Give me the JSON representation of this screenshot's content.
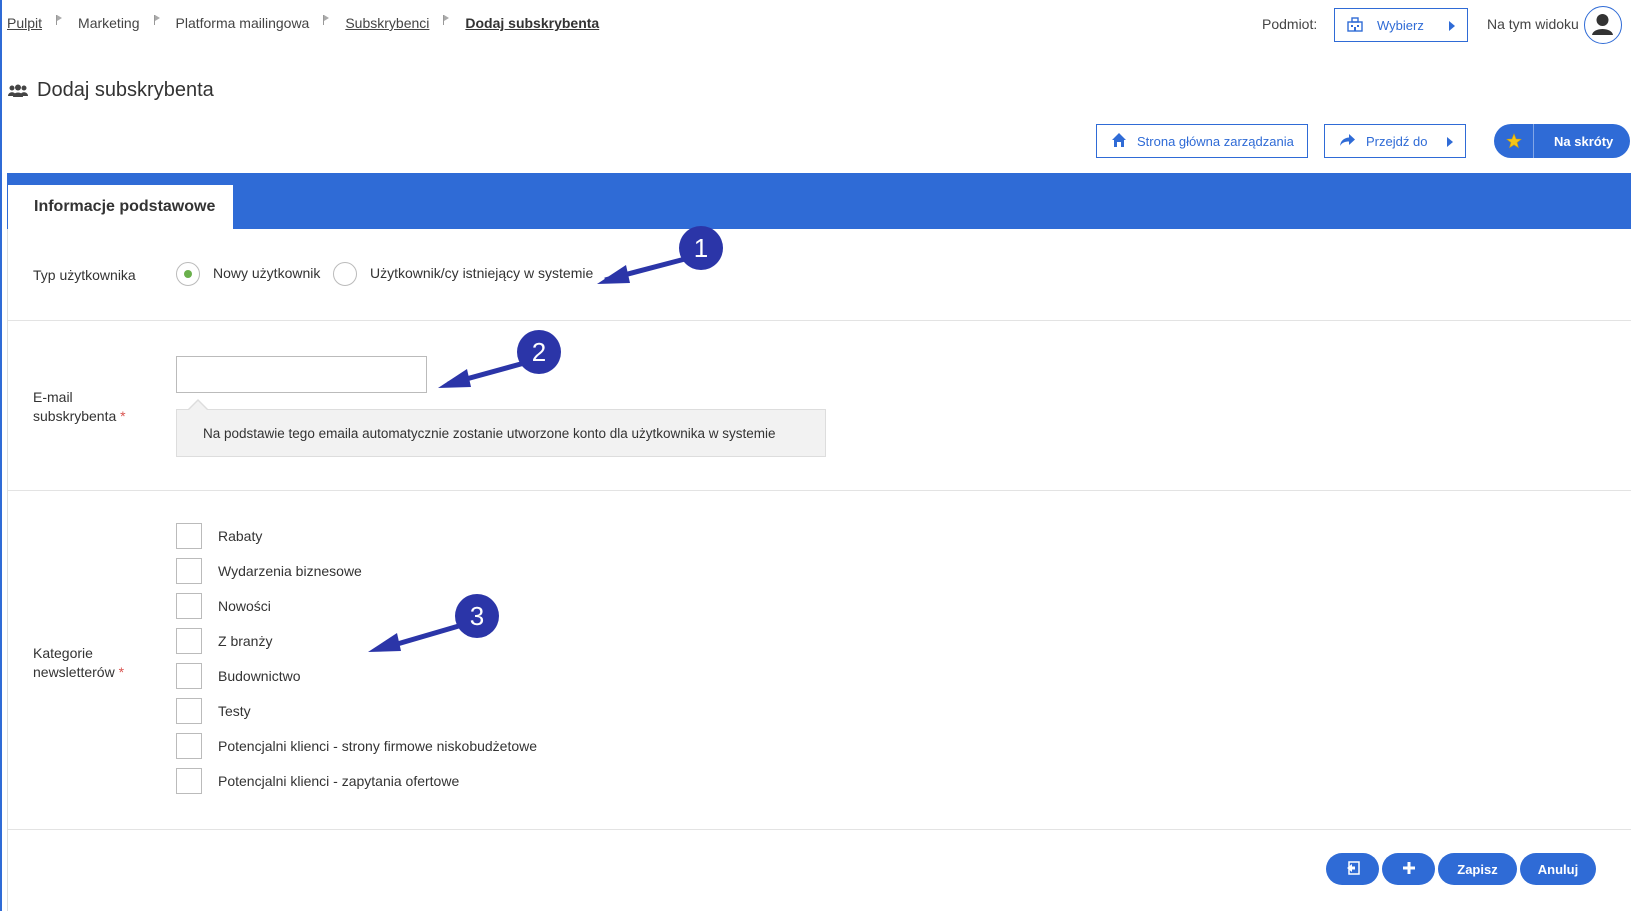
{
  "breadcrumb": {
    "items": [
      "Pulpit",
      "Marketing",
      "Platforma mailingowa",
      "Subskrybenci",
      "Dodaj subskrybenta"
    ]
  },
  "topbar": {
    "subject_label": "Podmiot:",
    "select_button": "Wybierz",
    "view_label": "Na tym widoku"
  },
  "page": {
    "title": "Dodaj subskrybenta"
  },
  "actions": {
    "home": "Strona główna zarządzania",
    "goto": "Przejdź do",
    "shortcuts": "Na skróty"
  },
  "tabs": {
    "active": "Informacje podstawowe"
  },
  "form": {
    "user_type": {
      "label": "Typ użytkownika",
      "options": [
        {
          "label": "Nowy użytkownik",
          "checked": true
        },
        {
          "label": "Użytkownik/cy istniejący w systemie",
          "checked": false
        }
      ]
    },
    "email": {
      "label_line1": "E-mail",
      "label_line2": "subskrybenta",
      "required_mark": "*",
      "value": "",
      "hint": "Na podstawie tego emaila automatycznie zostanie utworzone konto dla użytkownika w systemie"
    },
    "categories": {
      "label_line1": "Kategorie",
      "label_line2": "newsletterów",
      "required_mark": "*",
      "items": [
        "Rabaty",
        "Wydarzenia biznesowe",
        "Nowości",
        "Z branży",
        "Budownictwo",
        "Testy",
        "Potencjalni klienci - strony firmowe niskobudżetowe",
        "Potencjalni klienci - zapytania ofertowe"
      ]
    }
  },
  "footer_buttons": {
    "save": "Zapisz",
    "cancel": "Anuluj"
  },
  "annotations": [
    "1",
    "2",
    "3"
  ],
  "colors": {
    "accent": "#2f6bd6",
    "annotation": "#2b35a8",
    "radio_checked": "#6ab04c",
    "required": "#d9534f"
  }
}
